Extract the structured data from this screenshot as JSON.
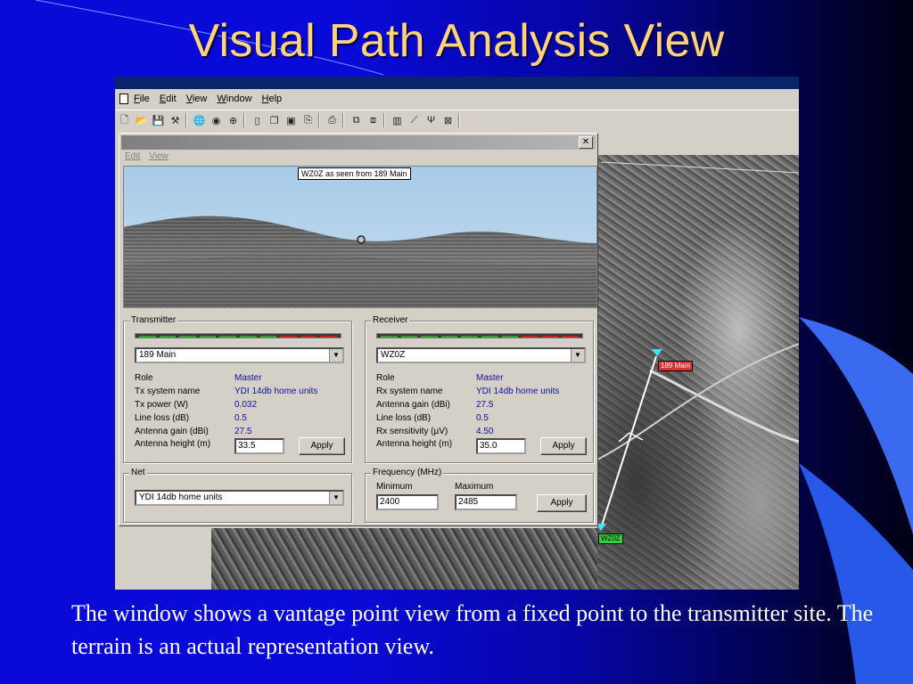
{
  "slide": {
    "title": "Visual Path Analysis View",
    "caption": "The window shows a vantage point view from a fixed point to the transmitter site. The terrain is an actual representation view."
  },
  "app": {
    "menu": [
      "File",
      "Edit",
      "View",
      "Window",
      "Help"
    ],
    "toolbar_icons": [
      "new-icon",
      "open-icon",
      "save-icon",
      "tools-icon",
      "globe-icon",
      "disk-icon",
      "search-globe-icon",
      "page-icon",
      "page-copy-icon",
      "page-stack-icon",
      "pdf-icon",
      "print-icon",
      "copy-icon",
      "paste-icon",
      "chart-icon",
      "link-icon",
      "antenna-icon",
      "close-box-icon"
    ]
  },
  "dialog": {
    "menu": {
      "edit": "Edit",
      "view": "View"
    },
    "close_glyph": "✕",
    "vista_label": "WZ0Z as seen from 189 Main",
    "transmitter": {
      "legend": "Transmitter",
      "site": "189 Main",
      "signal_bars": [
        "green",
        "green",
        "green",
        "green",
        "green",
        "green",
        "green",
        "red",
        "red",
        "red"
      ],
      "rows": [
        {
          "label": "Role",
          "value": "Master"
        },
        {
          "label": "Tx system name",
          "value": "YDI 14db home units"
        },
        {
          "label": "Tx power (W)",
          "value": "0.032"
        },
        {
          "label": "Line loss (dB)",
          "value": "0.5"
        },
        {
          "label": "Antenna gain (dBi)",
          "value": "27.5"
        }
      ],
      "height_label": "Antenna height (m)",
      "height_value": "33.5",
      "apply_label": "Apply"
    },
    "receiver": {
      "legend": "Receiver",
      "site": "WZ0Z",
      "signal_bars": [
        "green",
        "green",
        "green",
        "green",
        "green",
        "green",
        "green",
        "red",
        "red",
        "red"
      ],
      "rows": [
        {
          "label": "Role",
          "value": "Master"
        },
        {
          "label": "Rx system name",
          "value": "YDI 14db home units"
        },
        {
          "label": "Antenna gain (dBi)",
          "value": "27.5"
        },
        {
          "label": "Line loss (dB)",
          "value": "0.5"
        },
        {
          "label": "Rx sensitivity (µV)",
          "value": "4.50"
        }
      ],
      "height_label": "Antenna height (m)",
      "height_value": "35.0",
      "apply_label": "Apply"
    },
    "net": {
      "legend": "Net",
      "value": "YDI 14db home units"
    },
    "frequency": {
      "legend": "Frequency (MHz)",
      "min_label": "Minimum",
      "max_label": "Maximum",
      "min_value": "2400",
      "max_value": "2485",
      "apply_label": "Apply"
    }
  },
  "map": {
    "site_a": "189 Main",
    "site_b": "WZ0Z"
  },
  "colors": {
    "meter_green": "#30a030",
    "meter_red": "#c02020",
    "value_blue": "#1010a0"
  }
}
